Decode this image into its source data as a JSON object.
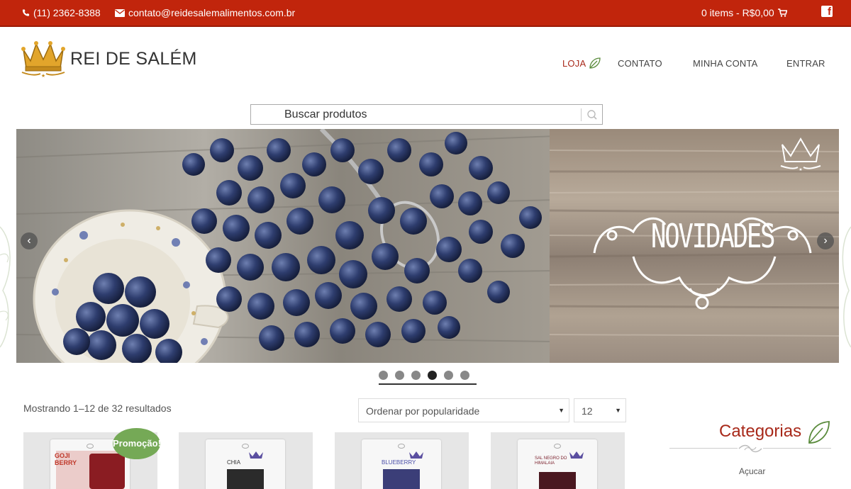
{
  "topbar": {
    "phone": "(11) 2362-8388",
    "email": "contato@reidesalemalimentos.com.br",
    "cart": "0 items - R$0,00",
    "social_icon": "facebook-icon"
  },
  "logo": {
    "text": "REI DE SALÉM"
  },
  "nav": [
    {
      "label": "LOJA",
      "active": true
    },
    {
      "label": "CONTATO"
    },
    {
      "label": "MINHA CONTA"
    },
    {
      "label": "ENTRAR"
    }
  ],
  "search": {
    "placeholder": "Buscar produtos"
  },
  "banner": {
    "headline": "NOVIDADES",
    "active_slide": 4,
    "slide_count": 6
  },
  "shop": {
    "result_count": "Mostrando 1–12 de 32 resultados",
    "sort_selected": "Ordenar por popularidade",
    "per_page_selected": "12",
    "sale_badge": "Promoção!",
    "products": [
      {
        "label": "GOJI BERRY",
        "color": "#c0392b"
      },
      {
        "label": "CHIA",
        "color": "#333333"
      },
      {
        "label": "BLUEBERRY",
        "color": "#4b4fa8"
      },
      {
        "label": "SAL NEGRO DO HIMALAIA",
        "color": "#7a1f2b"
      }
    ]
  },
  "sidebar": {
    "title": "Categorias",
    "items": [
      "Açucar"
    ]
  },
  "colors": {
    "topbar": "#c1250c",
    "accent": "#a8291a",
    "sale": "#75a956"
  }
}
